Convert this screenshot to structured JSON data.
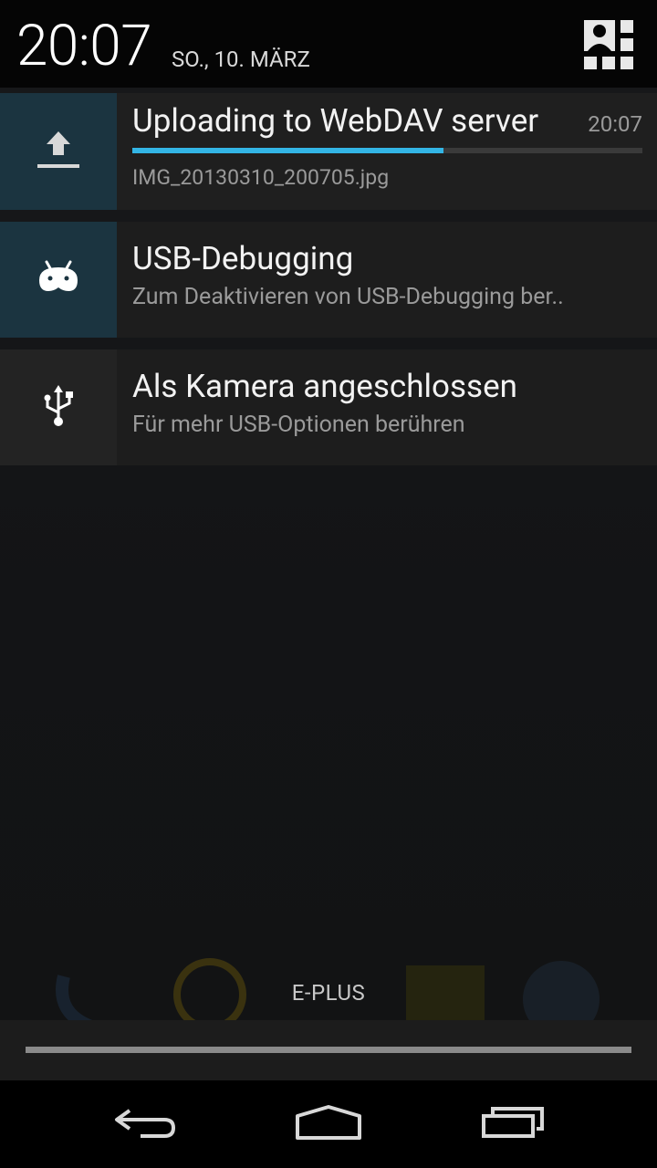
{
  "status": {
    "time": "20:07",
    "date": "SO., 10. MÄRZ",
    "quick_settings_icon": "quick-settings-icon"
  },
  "notifications": [
    {
      "icon": "upload-icon",
      "title": "Uploading to WebDAV server",
      "time": "20:07",
      "text": "IMG_20130310_200705.jpg",
      "progress": 0.61
    },
    {
      "icon": "android-debug-icon",
      "title": "USB-Debugging",
      "text": "Zum Deaktivieren von USB-Debugging ber.."
    },
    {
      "icon": "usb-icon",
      "title": "Als Kamera angeschlossen",
      "text": "Für mehr USB-Optionen berühren"
    }
  ],
  "carrier": "E-PLUS",
  "colors": {
    "accent": "#33b5e5",
    "icon_background": "#1b3440"
  },
  "nav": {
    "back": "back-icon",
    "home": "home-icon",
    "recents": "recents-icon"
  }
}
